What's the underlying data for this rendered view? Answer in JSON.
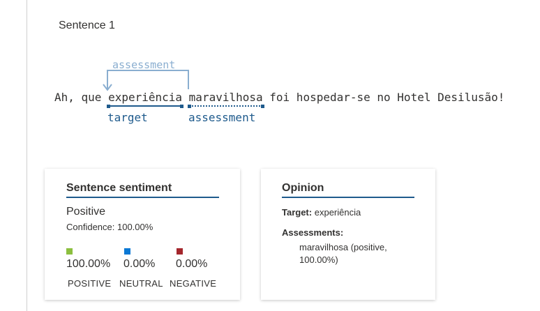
{
  "sentence": {
    "label": "Sentence 1",
    "text_before": "Ah, que ",
    "target_token": "experiência",
    "space": " ",
    "assessment_token": "maravilhosa",
    "text_after": " foi hospedar-se no Hotel Desilusão!",
    "relation_label": "assessment",
    "target_role": "target",
    "assessment_role": "assessment"
  },
  "sentiment_card": {
    "title": "Sentence sentiment",
    "sentiment": "Positive",
    "confidence": "Confidence: 100.00%",
    "scores": [
      {
        "name": "POSITIVE",
        "value": "100.00%",
        "color": "#8cbf3f"
      },
      {
        "name": "NEUTRAL",
        "value": "0.00%",
        "color": "#0a78d4"
      },
      {
        "name": "NEGATIVE",
        "value": "0.00%",
        "color": "#a4262c"
      }
    ]
  },
  "opinion_card": {
    "title": "Opinion",
    "target_key": "Target:",
    "target_value": "experiência",
    "assessments_key": "Assessments:",
    "assessments_value": "maravilhosa (positive, 100.00%)"
  },
  "colors": {
    "accent": "#1e5a8c",
    "relation": "#8aaed0"
  }
}
